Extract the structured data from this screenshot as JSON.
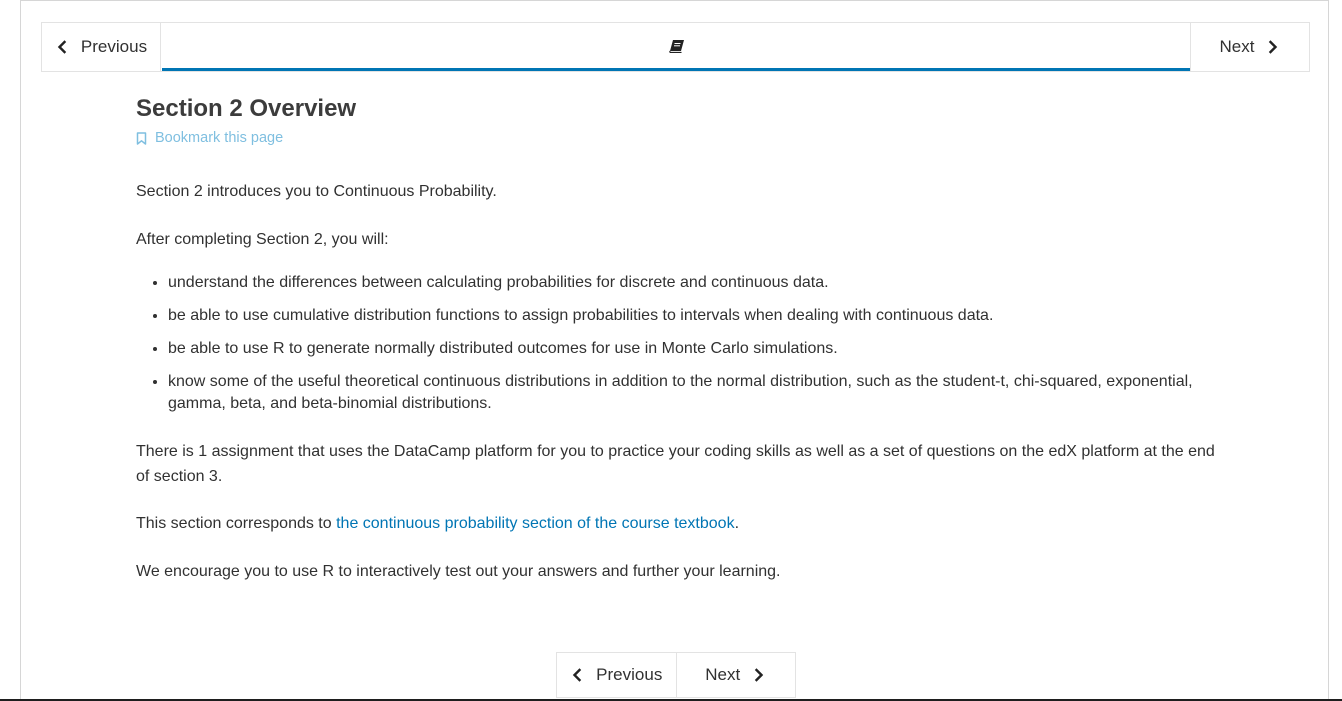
{
  "sequence_nav": {
    "previous_label": "Previous",
    "next_label": "Next",
    "active_tab_icon": "book-icon"
  },
  "unit": {
    "title": "Section 2 Overview",
    "bookmark_label": "Bookmark this page",
    "intro": "Section 2 introduces you to Continuous Probability.",
    "after_completing": "After completing Section 2, you will:",
    "goals": [
      "understand the differences between calculating probabilities for discrete and continuous data.",
      "be able to use cumulative distribution functions to assign probabilities to intervals when dealing with continuous data.",
      "be able to use R to generate normally distributed outcomes for use in Monte Carlo simulations.",
      "know some of the useful theoretical continuous distributions in addition to the normal distribution, such as the student-t, chi-squared, exponential, gamma, beta, and beta-binomial distributions."
    ],
    "assignment_text": "There is 1 assignment that uses the DataCamp platform for you to practice your coding skills as well as a set of questions on the edX platform at the end of section 3.",
    "corresponds_prefix": "This section corresponds to ",
    "textbook_link_text": "the continuous probability section of the course textbook",
    "corresponds_suffix": ".",
    "encourage_text": "We encourage you to use R to interactively test out your answers and further your learning."
  },
  "bottom_nav": {
    "previous_label": "Previous",
    "next_label": "Next"
  },
  "colors": {
    "accent": "#0075b4",
    "bookmark": "#7fbfe0",
    "text": "#313131"
  }
}
